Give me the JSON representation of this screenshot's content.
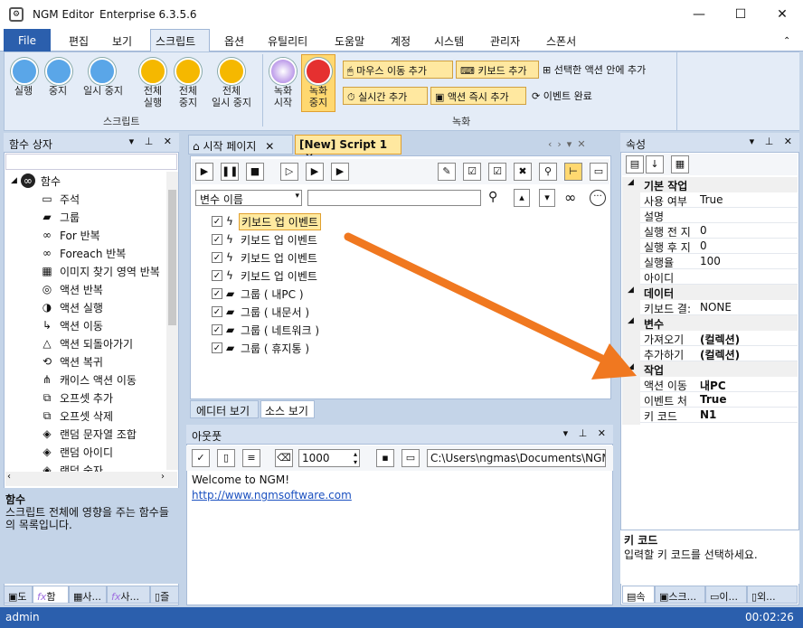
{
  "window": {
    "title": "NGM Editor",
    "edition": "Enterprise 6.3.5.6",
    "minimize": "—",
    "maximize": "☐",
    "close": "✕"
  },
  "menu": {
    "file": "File",
    "items": [
      "편집",
      "보기",
      "스크립트",
      "옵션",
      "유틸리티",
      "도움말",
      "계정",
      "시스템",
      "관리자",
      "스폰서"
    ]
  },
  "ribbon": {
    "play": "실행",
    "stop": "중지",
    "pause": "일시 중지",
    "play_all": "전체\n실행",
    "stop_all": "전체\n중지",
    "pause_all": "전체\n일시 중지",
    "group_script": "스크립트",
    "rec_start": "녹화\n시작",
    "rec_stop": "녹화\n중지",
    "add_mouse": "마우스 이동 추가",
    "add_key": "키보드 추가",
    "add_in_selected": "선택한 액션 안에 추가",
    "add_realtime": "실시간 추가",
    "add_instant": "액션 즉시 추가",
    "event_done": "이벤트 완료",
    "group_record": "녹화"
  },
  "left_panel": {
    "title": "함수 상자",
    "root": "함수",
    "items": [
      "주석",
      "그룹",
      "For 반복",
      "Foreach 반복",
      "이미지 찾기 영역 반복",
      "액션 반복",
      "액션 실행",
      "액션 이동",
      "액션 되돌아가기",
      "액션 복귀",
      "캐이스 액션 이동",
      "오프셋 추가",
      "오프셋 삭제",
      "랜덤 문자열 조합",
      "랜덤 아이디",
      "랜덤 숫자"
    ],
    "desc_title": "함수",
    "desc_text": "스크립트 전체에 영향을 주는 함수들의 목록입니다.",
    "bottom_tabs": [
      "도",
      "함",
      "사...",
      "사...",
      "즐"
    ]
  },
  "editor": {
    "tab_start": "시작 페이지",
    "tab_script": "[New] Script 1",
    "var_select": "변수 이름",
    "actions": [
      "키보드 업 이벤트",
      "키보드 업 이벤트",
      "키보드 업 이벤트",
      "키보드 업 이벤트",
      "그룹 ( 내PC )",
      "그룹 ( 내문서 )",
      "그룹 ( 네트워크 )",
      "그룹 ( 휴지통 )"
    ],
    "bottom_tab_editor": "에디터 보기",
    "bottom_tab_source": "소스 보기"
  },
  "output": {
    "title": "아웃풋",
    "count": "1000",
    "path": "C:\\Users\\ngmas\\Documents\\NGM6\\",
    "line1": "Welcome to NGM!",
    "link": "http://www.ngmsoftware.com"
  },
  "properties": {
    "title": "속성",
    "cat_basic": "기본 작업",
    "basic": [
      [
        "사용 여부",
        "True"
      ],
      [
        "설명",
        ""
      ],
      [
        "실행 전 지",
        "0"
      ],
      [
        "실행 후 지",
        "0"
      ],
      [
        "실행율",
        "100"
      ],
      [
        "아이디",
        ""
      ]
    ],
    "cat_data": "데이터",
    "data": [
      [
        "키보드 결:",
        "NONE"
      ]
    ],
    "cat_var": "변수",
    "var": [
      [
        "가져오기",
        "(컬렉션)"
      ],
      [
        "추가하기",
        "(컬렉션)"
      ]
    ],
    "cat_work": "작업",
    "work": [
      [
        "액션 이동",
        "내PC"
      ],
      [
        "이벤트 처",
        "True"
      ],
      [
        "키 코드",
        "N1"
      ]
    ],
    "desc_title": "키 코드",
    "desc_text": "입력할 키 코드를 선택하세요.",
    "bottom_tabs": [
      "속",
      "스크...",
      "이...",
      "외..."
    ]
  },
  "status": {
    "user": "admin",
    "time": "00:02:26"
  },
  "colors": {
    "accent": "#2b5fad",
    "arrow": "#f07820",
    "highlight": "#ffeaa0"
  }
}
